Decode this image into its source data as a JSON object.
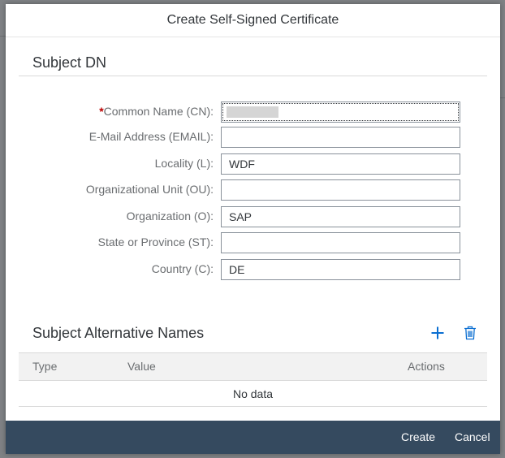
{
  "dialog": {
    "title": "Create Self-Signed Certificate"
  },
  "subject_dn": {
    "title": "Subject DN",
    "fields": [
      {
        "label": "Common Name (CN):",
        "required": true,
        "value": "",
        "redacted": true
      },
      {
        "label": "E-Mail Address (EMAIL):",
        "value": ""
      },
      {
        "label": "Locality (L):",
        "value": "WDF"
      },
      {
        "label": "Organizational Unit (OU):",
        "value": ""
      },
      {
        "label": "Organization (O):",
        "value": "SAP"
      },
      {
        "label": "State or Province (ST):",
        "value": ""
      },
      {
        "label": "Country (C):",
        "value": "DE"
      }
    ],
    "required_marker": "*"
  },
  "san": {
    "title": "Subject Alternative Names",
    "add_icon": "add-icon",
    "delete_icon": "delete-icon",
    "table": {
      "columns": [
        "Type",
        "Value",
        "Actions"
      ],
      "empty_text": "No data"
    }
  },
  "footer": {
    "create_label": "Create",
    "cancel_label": "Cancel"
  },
  "colors": {
    "accent": "#0a6ed1",
    "footer": "#354a5f",
    "required": "#bb0000"
  }
}
